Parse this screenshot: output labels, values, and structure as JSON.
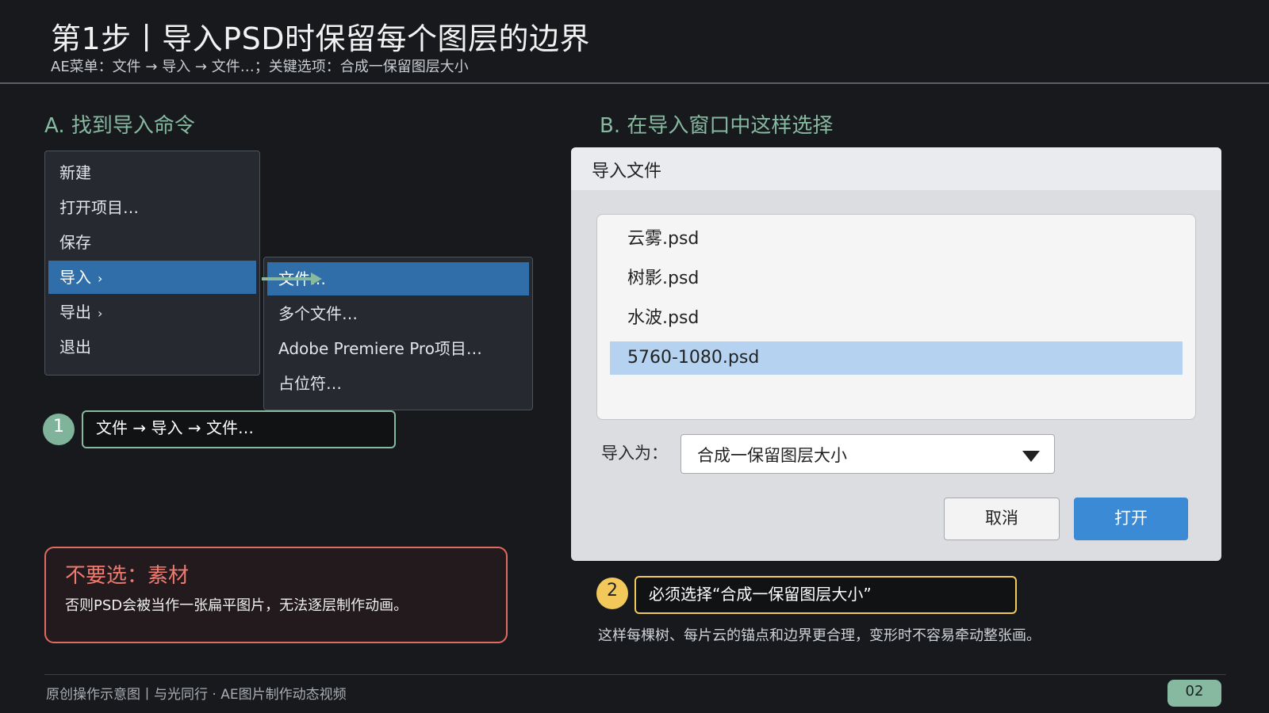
{
  "header": {
    "title": "第1步丨导入PSD时保留每个图层的边界",
    "subtitle": "AE菜单：文件 → 导入 → 文件…；关键选项：合成一保留图层大小"
  },
  "section_a": {
    "heading": "A. 找到导入命令",
    "menu": [
      {
        "label": "新建"
      },
      {
        "label": "打开项目…"
      },
      {
        "label": "保存"
      },
      {
        "label": "导入",
        "chevron": "›",
        "active": true
      },
      {
        "label": "导出",
        "chevron": "›"
      },
      {
        "label": "退出"
      }
    ],
    "submenu": [
      {
        "label": "文件…",
        "active": true
      },
      {
        "label": "多个文件…"
      },
      {
        "label": "Adobe Premiere Pro项目…"
      },
      {
        "label": "占位符…"
      }
    ],
    "step_number": "1",
    "step_text": "文件 → 导入 → 文件…"
  },
  "warning": {
    "title": "不要选：素材",
    "text": "否则PSD会被当作一张扁平图片，无法逐层制作动画。"
  },
  "section_b": {
    "heading": "B. 在导入窗口中这样选择",
    "dialog": {
      "title": "导入文件",
      "files": [
        "云雾.psd",
        "树影.psd",
        "水波.psd",
        "5760-1080.psd"
      ],
      "selected_file": "5760-1080.psd",
      "import_as_label": "导入为：",
      "import_as_value": "合成一保留图层大小",
      "cancel_label": "取消",
      "open_label": "打开"
    },
    "step_number": "2",
    "step_text": "必须选择“合成一保留图层大小”",
    "note": "这样每棵树、每片云的锚点和边界更合理，变形时不容易牵动整张画。"
  },
  "footer": {
    "text": "原创操作示意图丨与光同行 ·   AE图片制作动态视频",
    "page": "02"
  },
  "colors": {
    "background": "#17191d",
    "accent_green": "#86b9a0",
    "accent_yellow": "#f2c85b",
    "warning_red": "#e06b62",
    "menu_highlight": "#2f6ea9",
    "open_button": "#3b8ad6",
    "file_selected": "#b5d3f0"
  }
}
